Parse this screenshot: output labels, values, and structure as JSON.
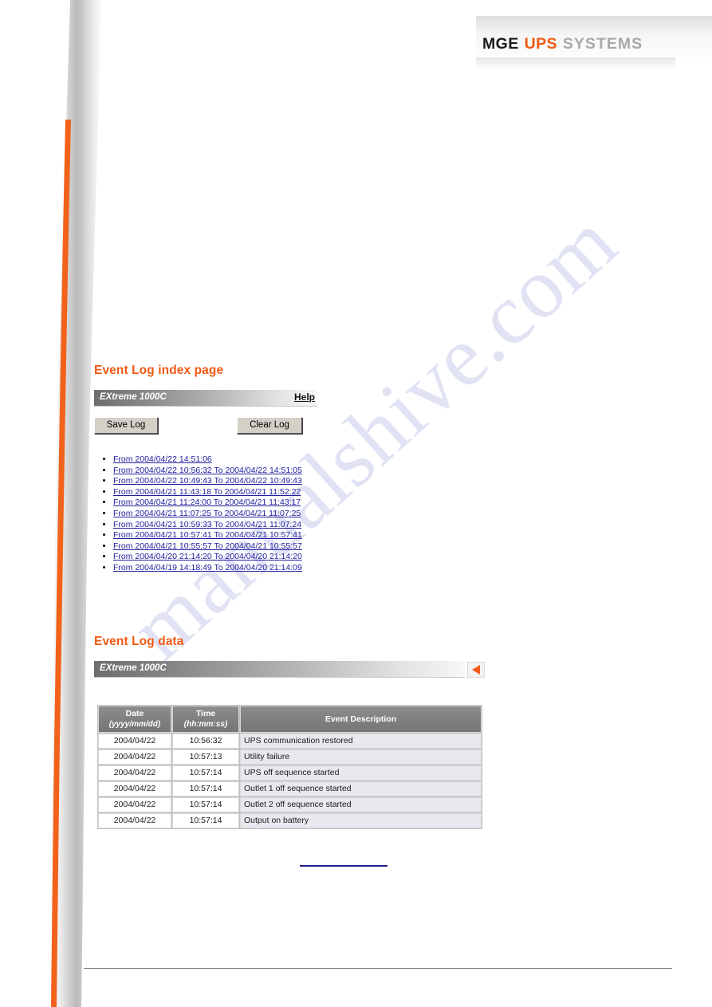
{
  "brand": {
    "logo_mge": "MGE",
    "logo_ups": "UPS",
    "logo_systems": "SYSTEMS",
    "accent_orange": "#ee5a10",
    "accent_gray": "#a8a8a8"
  },
  "watermark": {
    "text": "manualshive.com"
  },
  "index_section": {
    "title": "Event Log index page",
    "device_name": "EXtreme 1000C",
    "help_label": "Help",
    "save_label": "Save Log",
    "clear_label": "Clear Log",
    "log_links": [
      "From 2004/04/22 14:51:06",
      "From 2004/04/22 10:56:32 To 2004/04/22 14:51:05",
      "From 2004/04/22 10:49:43 To 2004/04/22 10:49:43",
      "From 2004/04/21 11:43:18 To 2004/04/21 11:52:22",
      "From 2004/04/21 11:24:00 To 2004/04/21 11:43:17",
      "From 2004/04/21 11:07:25 To 2004/04/21 11:07:25",
      "From 2004/04/21 10:59:33 To 2004/04/21 11:07:24",
      "From 2004/04/21 10:57:41 To 2004/04/21 10:57:41",
      "From 2004/04/21 10:55:57 To 2004/04/21 10:55:57",
      "From 2004/04/20 21:14:20 To 2004/04/20 21:14:20",
      "From 2004/04/19 14:18:49 To 2004/04/20 21:14:09"
    ]
  },
  "data_section": {
    "title": "Event Log data",
    "device_name": "EXtreme 1000C",
    "back_icon": "back-arrow-icon",
    "columns": [
      {
        "label": "Date",
        "unit": "(yyyy/mm/dd)"
      },
      {
        "label": "Time",
        "unit": "(hh:mm:ss)"
      },
      {
        "label": "Event Description",
        "unit": ""
      }
    ],
    "rows": [
      {
        "date": "2004/04/22",
        "time": "10:56:32",
        "event": "UPS communication restored"
      },
      {
        "date": "2004/04/22",
        "time": "10:57:13",
        "event": "Utility failure"
      },
      {
        "date": "2004/04/22",
        "time": "10:57:14",
        "event": "UPS off sequence started"
      },
      {
        "date": "2004/04/22",
        "time": "10:57:14",
        "event": "Outlet 1 off sequence started"
      },
      {
        "date": "2004/04/22",
        "time": "10:57:14",
        "event": "Outlet 2 off sequence started"
      },
      {
        "date": "2004/04/22",
        "time": "10:57:14",
        "event": "Output on battery"
      }
    ]
  }
}
